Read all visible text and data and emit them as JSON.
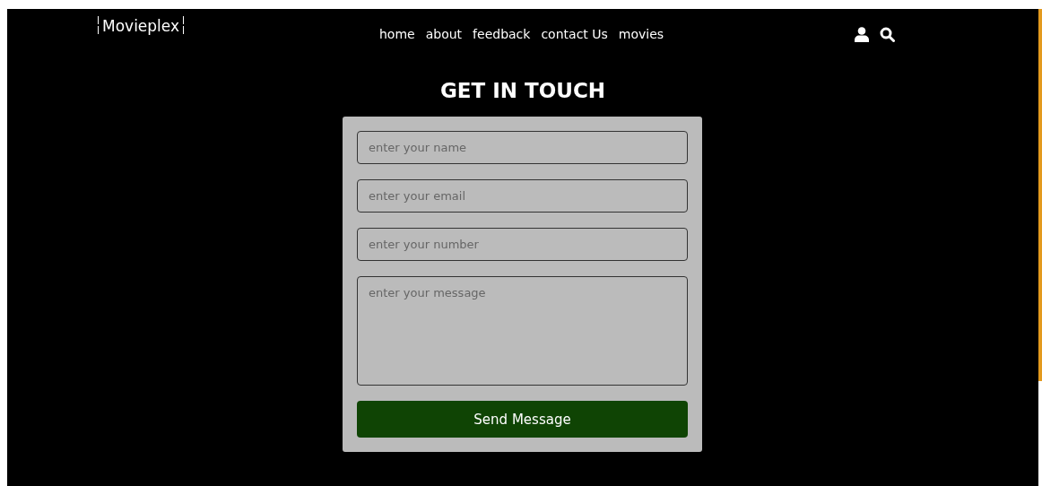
{
  "header": {
    "logo": "Movieplex",
    "nav": [
      {
        "label": "home"
      },
      {
        "label": "about"
      },
      {
        "label": "feedback"
      },
      {
        "label": "contact Us"
      },
      {
        "label": "movies"
      }
    ]
  },
  "contact": {
    "title": "GET IN TOUCH",
    "fields": [
      {
        "kind": "input",
        "placeholder": "enter your name"
      },
      {
        "kind": "input",
        "placeholder": "enter your email"
      },
      {
        "kind": "input",
        "placeholder": "enter your number"
      },
      {
        "kind": "textarea",
        "placeholder": "enter your message"
      }
    ],
    "submit": "Send Message"
  }
}
